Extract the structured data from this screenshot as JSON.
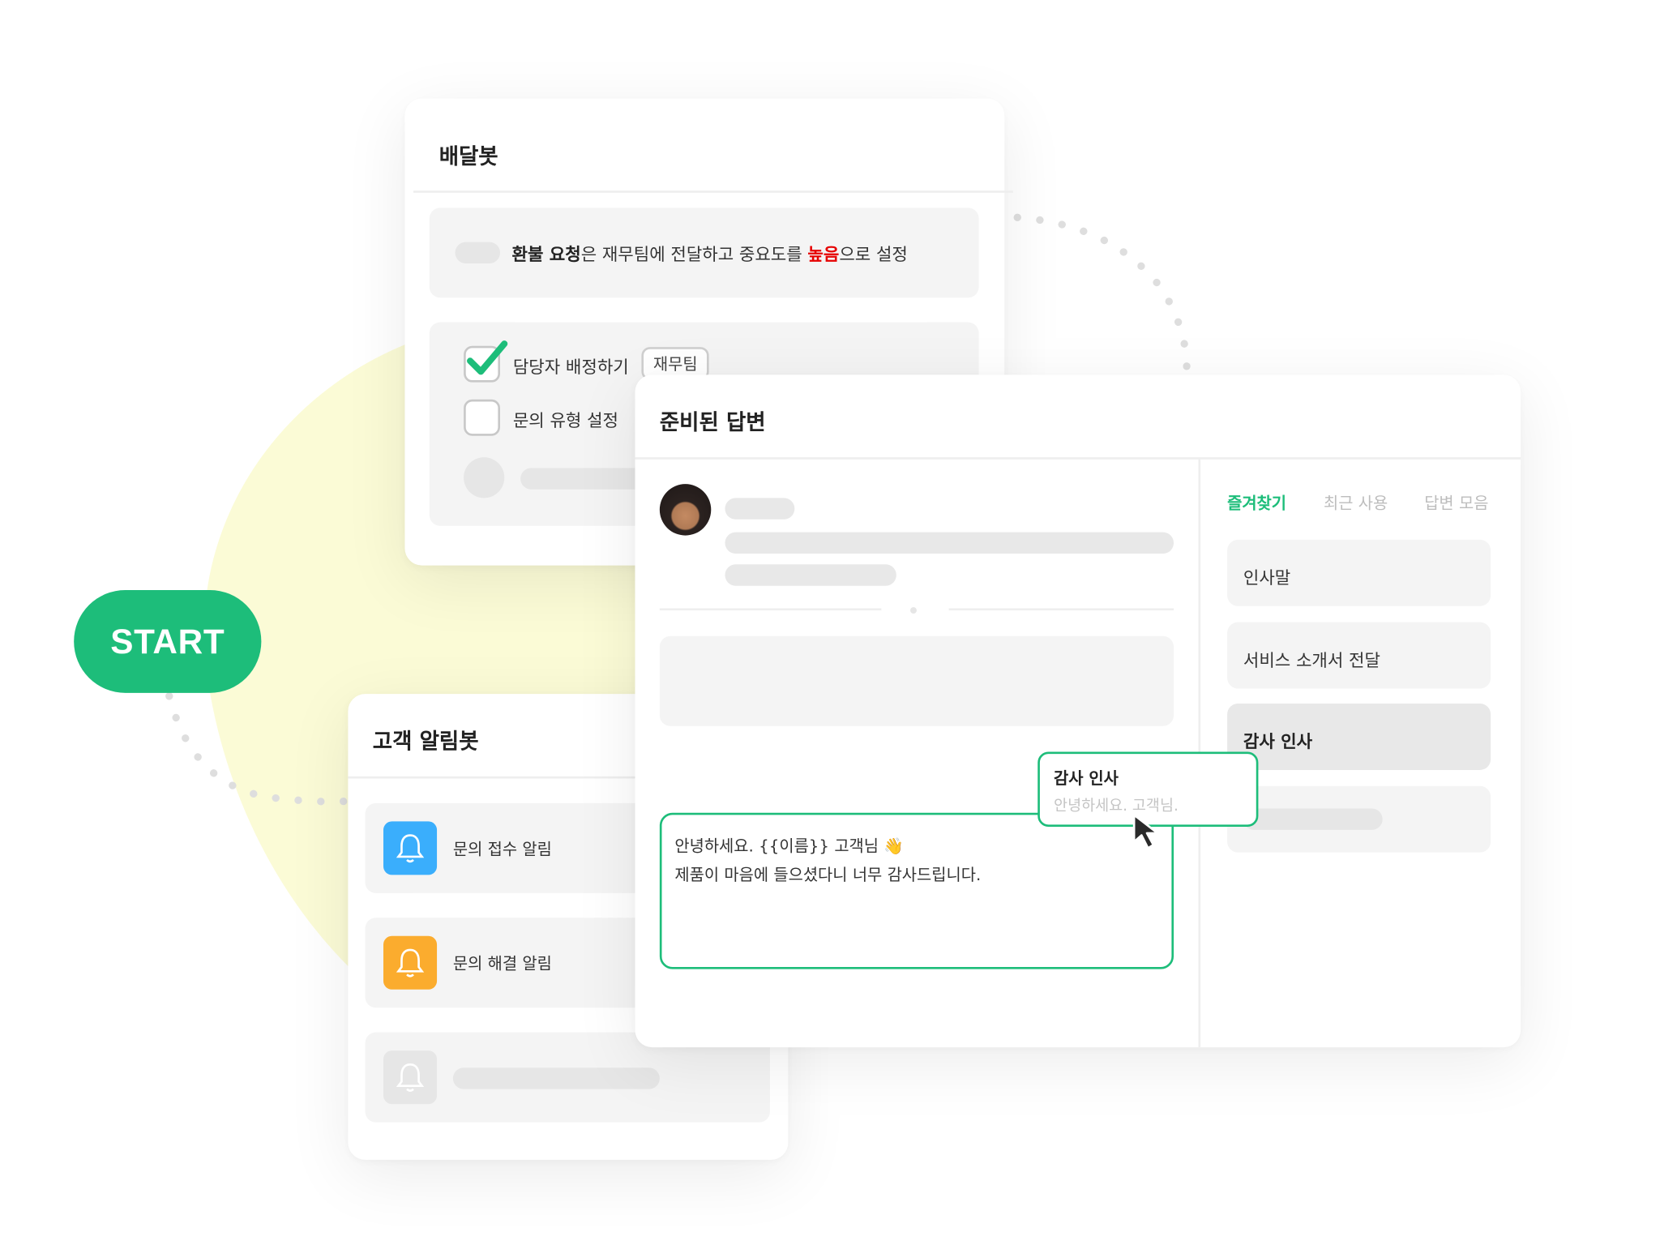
{
  "colors": {
    "accent": "#1dbd7a",
    "highlight_red": "#e60000",
    "bell_blue": "#3aaefc",
    "bell_orange": "#fbac2e",
    "bell_grey": "#e6e6e6"
  },
  "start_button": {
    "label": "START"
  },
  "delivery_bot": {
    "title": "배달봇",
    "rule": {
      "part1": "환불 요청",
      "part2": "은 재무팀에 전달하고 중요도를 ",
      "part3": "높음",
      "part4": "으로 설정"
    },
    "options": [
      {
        "label": "담당자 배정하기",
        "checked": true,
        "tag": "재무팀"
      },
      {
        "label": "문의 유형 설정",
        "checked": false
      }
    ]
  },
  "notify_bot": {
    "title": "고객 알림봇",
    "items": [
      {
        "label": "문의 접수 알림",
        "icon": "bell-icon"
      },
      {
        "label": "문의 해결 알림",
        "icon": "bell-icon"
      }
    ]
  },
  "prepared_replies": {
    "title": "준비된 답변",
    "tabs": [
      "즐겨찾기",
      "최근 사용",
      "답변 모음"
    ],
    "active_tab": "즐겨찾기",
    "items": [
      "인사말",
      "서비스 소개서 전달",
      "감사 인사"
    ],
    "selected_item": "감사 인사",
    "editor": {
      "line1": "안녕하세요. {{이름}} 고객님 👋",
      "line2": "제품이 마음에 들으셨다니 너무 감사드립니다."
    },
    "tooltip": {
      "title": "감사 인사",
      "preview": "안녕하세요. 고객님."
    }
  }
}
